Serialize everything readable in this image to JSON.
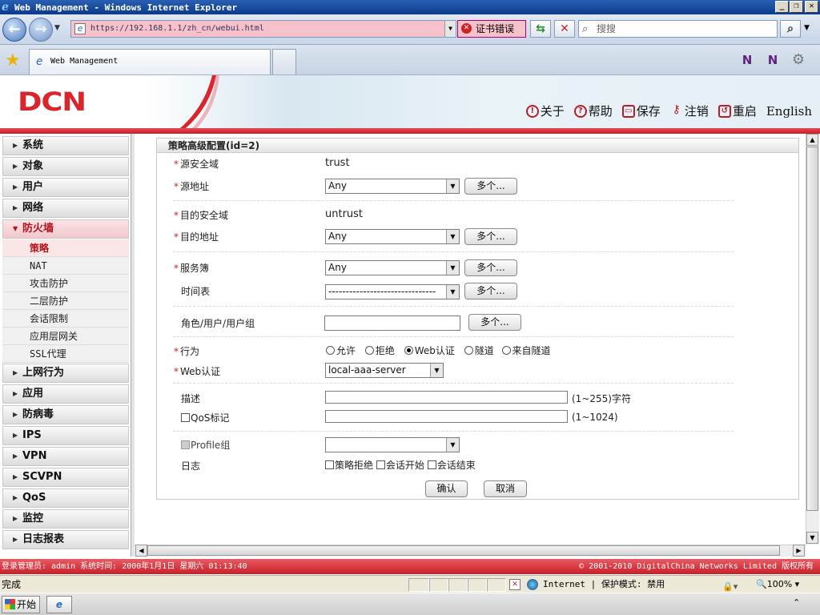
{
  "window": {
    "title": "Web Management - Windows Internet Explorer"
  },
  "browser": {
    "url": "https://192.168.1.1/zh_cn/webui.html",
    "cert_error": "证书错误",
    "search_placeholder": "搜搜",
    "tab_title": "Web Management"
  },
  "header": {
    "logo": "DCN",
    "links": [
      {
        "label": "关于",
        "icon": "info-icon"
      },
      {
        "label": "帮助",
        "icon": "help-icon"
      },
      {
        "label": "保存",
        "icon": "save-icon"
      },
      {
        "label": "注销",
        "icon": "logout-key-icon"
      },
      {
        "label": "重启",
        "icon": "reboot-icon"
      },
      {
        "label": "English",
        "icon": ""
      }
    ]
  },
  "sidebar": {
    "items": [
      {
        "label": "系统"
      },
      {
        "label": "对象"
      },
      {
        "label": "用户"
      },
      {
        "label": "网络"
      },
      {
        "label": "防火墙",
        "expanded": true
      }
    ],
    "sub_items": [
      "策略",
      "NAT",
      "攻击防护",
      "二层防护",
      "会话限制",
      "应用层网关",
      "SSL代理"
    ],
    "items_after": [
      "上网行为",
      "应用",
      "防病毒",
      "IPS",
      "VPN",
      "SCVPN",
      "QoS",
      "监控",
      "日志报表"
    ]
  },
  "form": {
    "title": "策略高级配置(id=2)",
    "src_zone_label": "源安全域",
    "src_zone_value": "trust",
    "src_addr_label": "源地址",
    "src_addr_value": "Any",
    "dst_zone_label": "目的安全域",
    "dst_zone_value": "untrust",
    "dst_addr_label": "目的地址",
    "dst_addr_value": "Any",
    "service_label": "服务簿",
    "service_value": "Any",
    "schedule_label": "时间表",
    "schedule_value": "-------------------------------",
    "role_label": "角色/用户/用户组",
    "action_label": "行为",
    "actions": [
      "允许",
      "拒绝",
      "Web认证",
      "隧道",
      "来自隧道"
    ],
    "action_selected": 2,
    "webauth_label": "Web认证",
    "webauth_value": "local-aaa-server",
    "desc_label": "描述",
    "desc_hint": "(1~255)字符",
    "qos_label": "QoS标记",
    "qos_hint": "(1~1024)",
    "profile_label": "Profile组",
    "log_label": "日志",
    "log_options": [
      "策略拒绝",
      "会话开始",
      "会话结束"
    ],
    "multi_label": "多个...",
    "ok_label": "确认",
    "cancel_label": "取消"
  },
  "footer": {
    "login_info": "登录管理员: admin 系统时间: 2000年1月1日 星期六 01:13:40",
    "copyright": "© 2001-2010 DigitalChina Networks Limited 版权所有"
  },
  "statusbar": {
    "text": "完成",
    "zone": "Internet | 保护模式: 禁用",
    "zoom": "100%"
  },
  "taskbar": {
    "start": "开始"
  }
}
